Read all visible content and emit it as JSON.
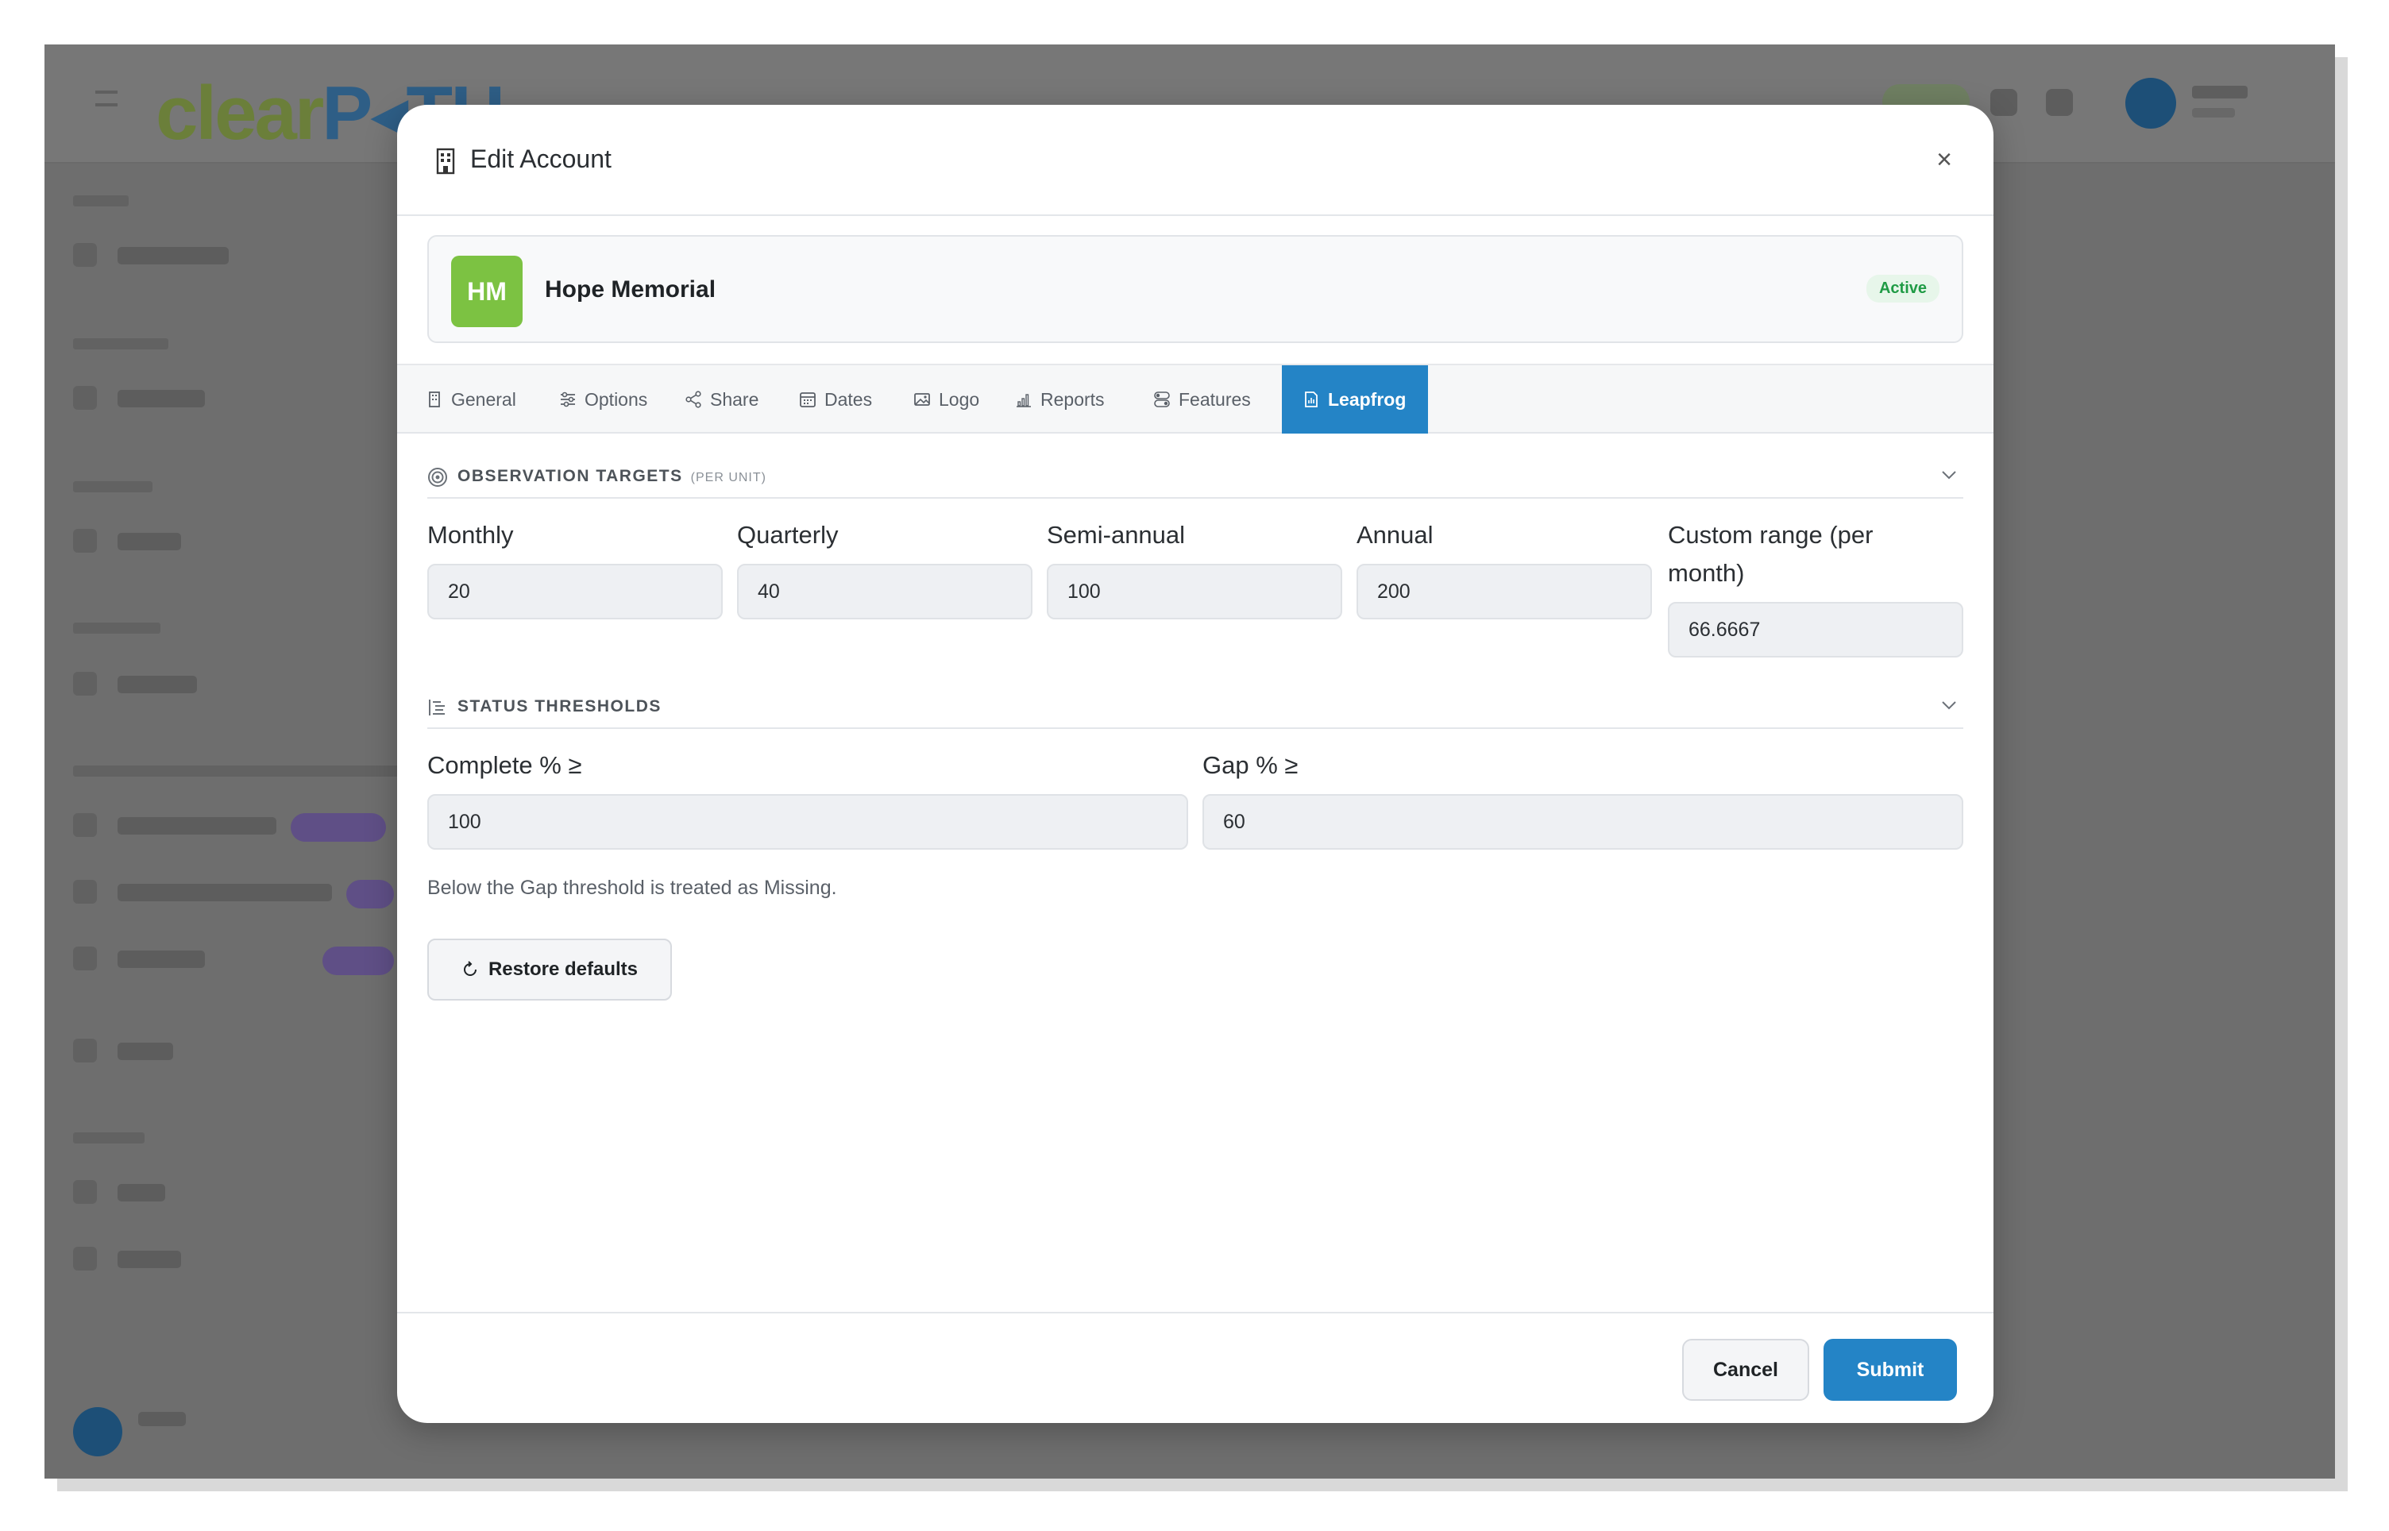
{
  "modal": {
    "title": "Edit Account",
    "title_icon": "building-icon",
    "close_label": "×"
  },
  "account": {
    "initials": "HM",
    "name": "Hope Memorial",
    "status": "Active",
    "avatar_color": "#7cc242",
    "status_color": "#1f9b45"
  },
  "tabs": [
    {
      "label": "General",
      "icon": "building-icon"
    },
    {
      "label": "Options",
      "icon": "sliders-icon"
    },
    {
      "label": "Share",
      "icon": "share-icon"
    },
    {
      "label": "Dates",
      "icon": "calendar-icon"
    },
    {
      "label": "Logo",
      "icon": "image-icon"
    },
    {
      "label": "Reports",
      "icon": "bar-chart-icon"
    },
    {
      "label": "Features",
      "icon": "toggles-icon"
    },
    {
      "label": "Leapfrog",
      "icon": "document-chart-icon",
      "active": true
    }
  ],
  "observation_targets": {
    "title": "OBSERVATION TARGETS",
    "subtitle": "(PER UNIT)",
    "fields": [
      {
        "label": "Monthly",
        "value": "20"
      },
      {
        "label": "Quarterly",
        "value": "40"
      },
      {
        "label": "Semi-annual",
        "value": "100"
      },
      {
        "label": "Annual",
        "value": "200"
      },
      {
        "label": "Custom range (per month)",
        "value": "66.6667"
      }
    ]
  },
  "status_thresholds": {
    "title": "STATUS THRESHOLDS",
    "fields": [
      {
        "label": "Complete % ≥",
        "value": "100"
      },
      {
        "label": "Gap % ≥",
        "value": "60"
      }
    ],
    "helper": "Below the Gap threshold is treated as Missing."
  },
  "buttons": {
    "restore": "Restore defaults",
    "cancel": "Cancel",
    "submit": "Submit"
  },
  "colors": {
    "accent": "#2484c6"
  }
}
